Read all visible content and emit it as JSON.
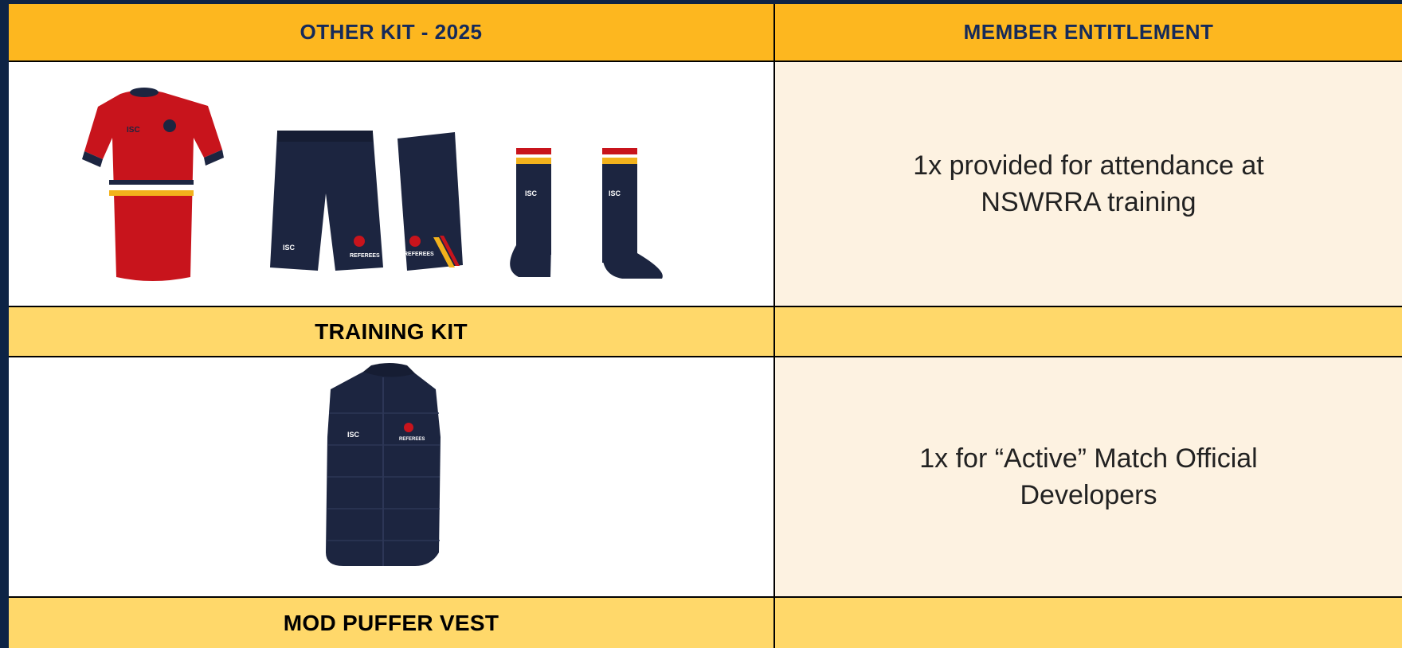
{
  "header": {
    "col1": "OTHER KIT - 2025",
    "col2": "MEMBER ENTITLEMENT"
  },
  "rows": [
    {
      "entitlement": "1x provided for attendance at NSWRRA training",
      "label": "TRAINING KIT",
      "items": [
        {
          "icon": "training-tee-icon",
          "logo": "ISC"
        },
        {
          "icon": "training-shorts-icon",
          "logo": "ISC"
        },
        {
          "icon": "training-socks-icon",
          "logo": "ISC"
        }
      ]
    },
    {
      "entitlement": "1x for “Active” Match Official Developers",
      "label": "MOD PUFFER VEST",
      "items": [
        {
          "icon": "puffer-vest-icon",
          "logo": "ISC"
        }
      ]
    }
  ],
  "colors": {
    "background": "#0d2345",
    "header": "#fdb71f",
    "label_row": "#ffd86a",
    "entitlement_bg": "#fdf2e1",
    "navy": "#1c2540",
    "red": "#c8141c",
    "gold": "#f2b21c"
  }
}
